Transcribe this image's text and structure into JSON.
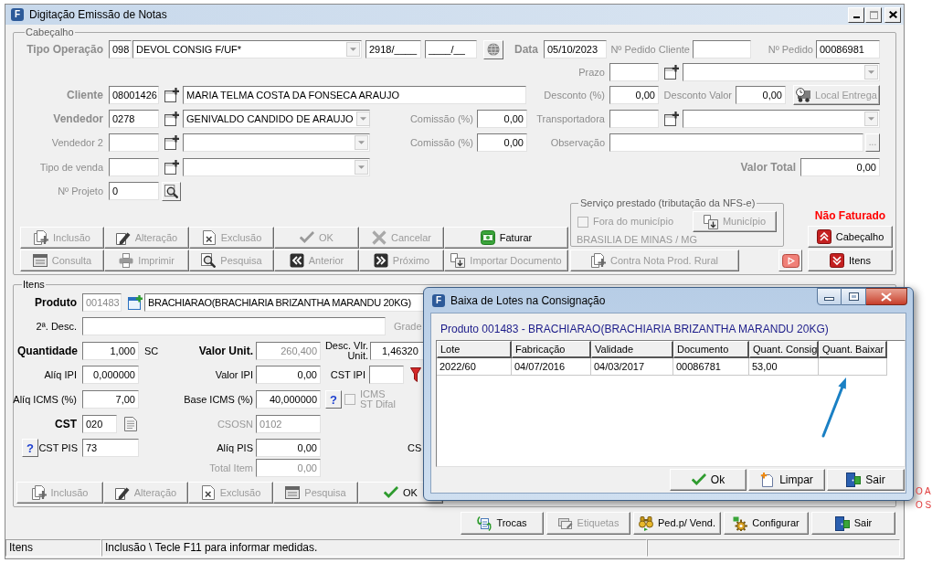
{
  "window": {
    "icon_letter": "F",
    "title": "Digitação Emissão de Notas"
  },
  "header": {
    "legend": "Cabeçalho",
    "disabled": true,
    "tipo_operacao": {
      "label": "Tipo Operação",
      "required": true,
      "code": "098",
      "description": "DEVOL CONSIG F/UF*",
      "number": "2918/____",
      "series": "____/__"
    },
    "data": {
      "label": "Data",
      "required": true,
      "value": "05/10/2023"
    },
    "pedido_cliente": {
      "label": "Nº Pedido Cliente",
      "required": false
    },
    "pedido": {
      "label": "Nº Pedido",
      "required": false,
      "value": "00086981"
    },
    "prazo": {
      "label": "Prazo",
      "required": false
    },
    "cliente": {
      "label": "Cliente",
      "required": true,
      "code": "08001426",
      "name": "MARIA TELMA COSTA DA FONSECA ARAUJO"
    },
    "desconto_percentual": {
      "label": "Desconto (%)",
      "required": false,
      "value": "0,00"
    },
    "desconto_valor": {
      "label": "Desconto Valor",
      "required": false,
      "value": "0,00"
    },
    "local_entrega_button": {
      "label": "Local Entrega",
      "disabled": true
    },
    "vendedor": {
      "label": "Vendedor",
      "required": true,
      "code": "0278",
      "name": "GENIVALDO CANDIDO DE ARAUJO"
    },
    "comissao": {
      "label": "Comissão (%)",
      "required": false,
      "value": "0,00"
    },
    "transportadora": {
      "label": "Transportadora",
      "required": false
    },
    "vendedor_2": {
      "label": "Vendedor 2",
      "required": false
    },
    "comissao_2": {
      "label": "Comissão (%)",
      "required": false,
      "value": "0,00"
    },
    "observacao": {
      "label": "Observação",
      "required": false,
      "button": "..."
    },
    "tipo_venda": {
      "label": "Tipo de venda",
      "required": false
    },
    "valor_total": {
      "label": "Valor Total",
      "required": true,
      "value": "0,00"
    },
    "projeto": {
      "label": "Nº Projeto",
      "required": false,
      "value": "0"
    },
    "servico": {
      "legend": "Serviço prestado (tributação da NFS-e)",
      "fora_municipio": {
        "label": "Fora do município",
        "checked": false,
        "disabled": true
      },
      "municipio_button": {
        "label": "Município",
        "disabled": true
      },
      "location": "BRASILIA DE MINAS / MG"
    },
    "invoice_status": "Não Faturado",
    "buttons": [
      {
        "label": "Inclusão",
        "disabled": true
      },
      {
        "label": "Alteração",
        "disabled": true
      },
      {
        "label": "Exclusão",
        "disabled": true
      },
      {
        "label": "OK",
        "disabled": true
      },
      {
        "label": "Cancelar",
        "disabled": true
      },
      {
        "label": "Faturar",
        "disabled": false
      },
      {
        "label": "Consulta",
        "disabled": true
      },
      {
        "label": "Imprimir",
        "disabled": true
      },
      {
        "label": "Pesquisa",
        "disabled": true
      },
      {
        "label": "Anterior",
        "disabled": true
      },
      {
        "label": "Próximo",
        "disabled": true
      },
      {
        "label": "Importar Documento",
        "disabled": true
      }
    ],
    "contra_nota_button": {
      "label": "Contra Nota Prod. Rural",
      "disabled": true
    },
    "section_buttons": [
      {
        "label": "Cabeçalho",
        "disabled": false
      },
      {
        "label": "Itens",
        "disabled": false
      }
    ]
  },
  "items": {
    "legend": "Itens",
    "produto": {
      "label": "Produto",
      "required": true,
      "disabled": true,
      "code": "001483",
      "name": "BRACHIARAO(BRACHIARIA BRIZANTHA MARANDU 20KG)"
    },
    "segunda_descricao": {
      "label": "2ª. Desc.",
      "required": false
    },
    "grade": {
      "label": "Grade",
      "required": false,
      "disabled": true
    },
    "quantidade": {
      "label": "Quantidade",
      "required": true,
      "disabled": false,
      "value": "1,000",
      "unit": "SC"
    },
    "valor_unitario": {
      "label": "Valor Unit.",
      "required": true,
      "disabled": true,
      "value": "260,400"
    },
    "desconto_valor_unitario": {
      "label_lines": [
        "Desc. Vlr.",
        "Unit."
      ],
      "required": false,
      "disabled": false,
      "value": "1,46320"
    },
    "aliq_ipi": {
      "label": "Alíq IPI",
      "required": false,
      "disabled": false,
      "value": "0,000000"
    },
    "valor_ipi": {
      "label": "Valor IPI",
      "required": false,
      "disabled": false,
      "value": "0,00"
    },
    "cst_ipi": {
      "label": "CST IPI",
      "required": false
    },
    "aliq_icms": {
      "label": "Alíq ICMS (%)",
      "required": false,
      "disabled": false,
      "value": "7,00"
    },
    "base_icms": {
      "label": "Base ICMS (%)",
      "required": false,
      "disabled": false,
      "value": "40,000000",
      "help_button": "?"
    },
    "icms_st_difal": {
      "label_lines": [
        "ICMS",
        "ST Difal"
      ],
      "checked": false,
      "disabled": true
    },
    "cst": {
      "label": "CST",
      "required": true,
      "disabled": false,
      "value": "020"
    },
    "csosn": {
      "label": "CSOSN",
      "required": false,
      "disabled": true,
      "value": "0102"
    },
    "cst_pis": {
      "help_button": "?",
      "label": "CST PIS",
      "required": false,
      "disabled": false,
      "value": "73"
    },
    "aliq_pis": {
      "label": "Alíq PIS",
      "required": false,
      "disabled": false,
      "value": "0,00"
    },
    "cut_label": "CS",
    "total_item": {
      "label": "Total Item",
      "required": false,
      "disabled": true,
      "value": "0,00"
    },
    "buttons": [
      {
        "label": "Inclusão",
        "disabled": true
      },
      {
        "label": "Alteração",
        "disabled": true
      },
      {
        "label": "Exclusão",
        "disabled": true
      },
      {
        "label": "Pesquisa",
        "disabled": true
      },
      {
        "label": "OK",
        "disabled": false
      }
    ]
  },
  "footer_buttons": [
    {
      "label": "Trocas",
      "disabled": false
    },
    {
      "label": "Etiquetas",
      "disabled": true
    },
    {
      "label": "Ped.p/ Vend.",
      "disabled": false
    },
    {
      "label": "Configurar",
      "disabled": false
    },
    {
      "label": "Sair",
      "disabled": false
    }
  ],
  "status_bar": {
    "panels": [
      "Itens",
      "Inclusão \\ Tecle F11 para informar medidas."
    ]
  },
  "dialog": {
    "icon_letter": "F",
    "title": "Baixa de Lotes na Consignação",
    "product": "Produto 001483 - BRACHIARAO(BRACHIARIA BRIZANTHA MARANDU 20KG)",
    "table": {
      "columns": [
        "Lote",
        "Fabricação",
        "Validade",
        "Documento",
        "Quant. Consig",
        "Quant. Baixar"
      ],
      "rows": [
        [
          "2022/60",
          "04/07/2016",
          "04/03/2017",
          "00086781",
          "53,00"
        ]
      ]
    },
    "buttons": [
      {
        "label": "Ok",
        "disabled": false
      },
      {
        "label": "Limpar",
        "disabled": false
      },
      {
        "label": "Sair",
        "disabled": false
      }
    ]
  },
  "background": {
    "texts": [
      "O A",
      "O S"
    ]
  }
}
